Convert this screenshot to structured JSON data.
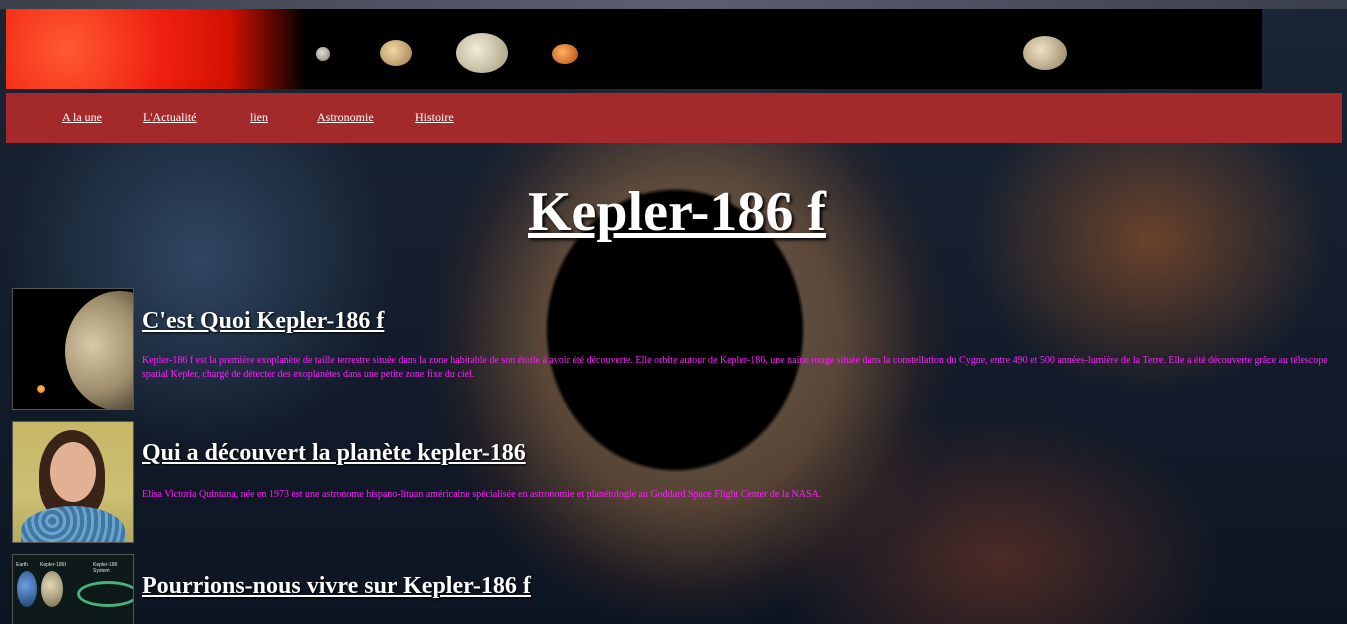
{
  "nav": {
    "items": [
      "A la une",
      "L'Actualité",
      "lien",
      "Astronomie",
      "Histoire"
    ]
  },
  "page": {
    "title": "Kepler-186 f"
  },
  "sections": [
    {
      "heading": "C'est Quoi Kepler-186 f",
      "text": "Kepler-186 f est la première exoplanète de taille terrestre située dans la zone habitable de son étoile à avoir été découverte. Elle orbite autour de Kepler-186, une naine rouge située dans la constellation du Cygne, entre 490 et 500 années-lumière de la Terre. Elle a été découverte grâce au télescope spatial Kepler, chargé de détecter des exoplanètes dans une petite zone fixe du ciel."
    },
    {
      "heading": "Qui a découvert la planète kepler-186",
      "text": "Elisa Victoria Quintana, née en 1973 est une astronome hispano-lituan américaine spécialisée en astronomie et planétologie au Goddard Space Flight Center de la NASA."
    },
    {
      "heading": "Pourrions-nous vivre sur Kepler-186 f"
    }
  ],
  "images": {
    "diagram_labels": [
      "Earth",
      "Kepler-186f",
      "Kepler-186 System"
    ]
  },
  "colors": {
    "navbar": "#a4292b",
    "body_text": "#ff1fff",
    "heading": "#ffffff"
  }
}
